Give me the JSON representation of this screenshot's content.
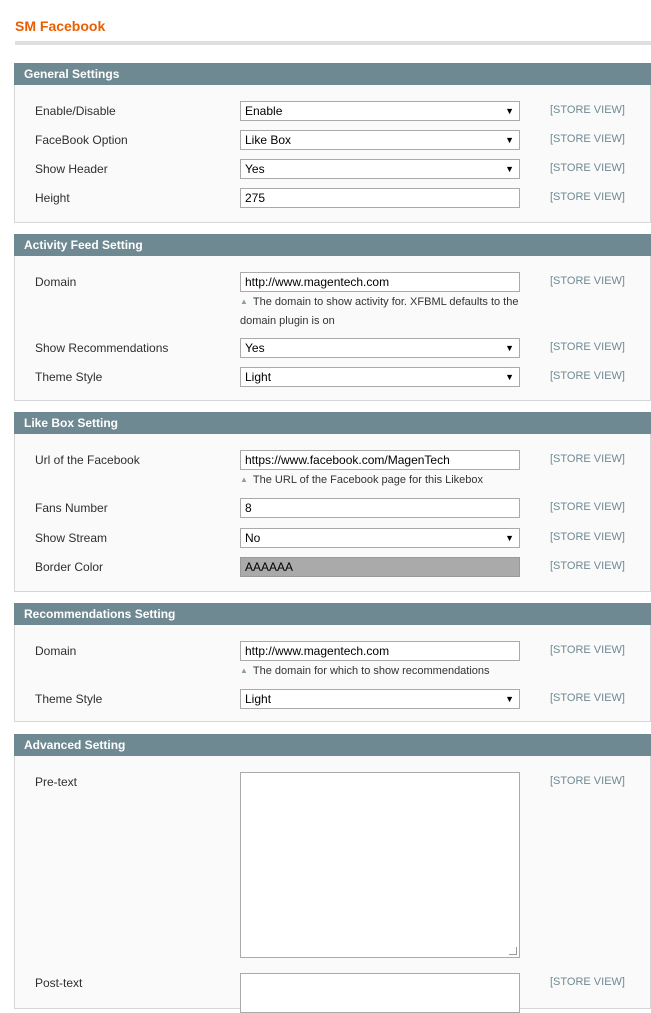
{
  "page": {
    "title": "SM Facebook"
  },
  "scope_label": "[STORE VIEW]",
  "general": {
    "heading": "General Settings",
    "enable": {
      "label": "Enable/Disable",
      "value": "Enable"
    },
    "facebook_option": {
      "label": "FaceBook Option",
      "value": "Like Box"
    },
    "show_header": {
      "label": "Show Header",
      "value": "Yes"
    },
    "height": {
      "label": "Height",
      "value": "275"
    }
  },
  "activity": {
    "heading": "Activity Feed Setting",
    "domain": {
      "label": "Domain",
      "value": "http://www.magentech.com",
      "note": "The domain to show activity for. XFBML defaults to the domain plugin is on"
    },
    "show_recommendations": {
      "label": "Show Recommendations",
      "value": "Yes"
    },
    "theme_style": {
      "label": "Theme Style",
      "value": "Light"
    }
  },
  "likebox": {
    "heading": "Like Box Setting",
    "url": {
      "label": "Url of the Facebook",
      "value": "https://www.facebook.com/MagenTech",
      "note": "The URL of the Facebook page for this Likebox"
    },
    "fans_number": {
      "label": "Fans Number",
      "value": "8"
    },
    "show_stream": {
      "label": "Show Stream",
      "value": "No"
    },
    "border_color": {
      "label": "Border Color",
      "value": "AAAAAA"
    }
  },
  "recommendations": {
    "heading": "Recommendations Setting",
    "domain": {
      "label": "Domain",
      "value": "http://www.magentech.com",
      "note": "The domain for which to show recommendations"
    },
    "theme_style": {
      "label": "Theme Style",
      "value": "Light"
    }
  },
  "advanced": {
    "heading": "Advanced Setting",
    "pre_text": {
      "label": "Pre-text",
      "value": ""
    },
    "post_text": {
      "label": "Post-text",
      "value": ""
    }
  },
  "colors": {
    "accent": "#eb5e00",
    "section_header": "#6f8992",
    "border_color_swatch": "#aaaaaa"
  },
  "icons": {
    "dropdown": "triangle-down",
    "note": "triangle-up"
  }
}
